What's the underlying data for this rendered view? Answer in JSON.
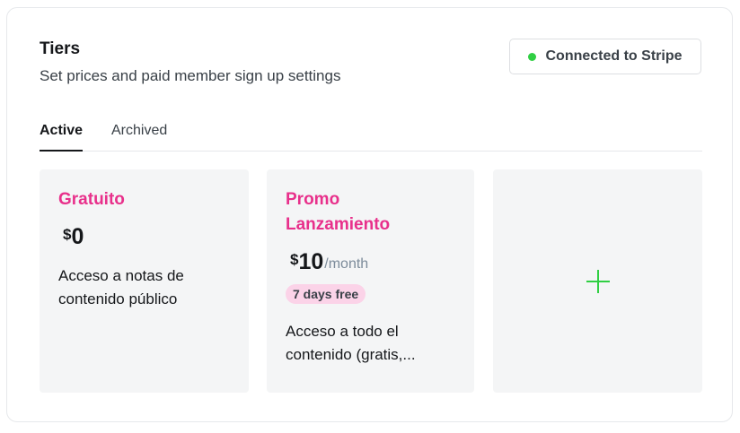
{
  "header": {
    "title": "Tiers",
    "subtitle": "Set prices and paid member sign up settings",
    "stripe_status": "Connected to Stripe"
  },
  "tabs": [
    {
      "label": "Active",
      "selected": true
    },
    {
      "label": "Archived",
      "selected": false
    }
  ],
  "tiers": [
    {
      "name": "Gratuito",
      "currency": "$",
      "amount": "0",
      "period": "",
      "badge": "",
      "description": "Acceso a notas de contenido público"
    },
    {
      "name_line1": "Promo",
      "name_line2": "Lanzamiento",
      "currency": "$",
      "amount": "10",
      "period": "/month",
      "badge": "7 days free",
      "description": "Acceso a todo el contenido (gratis,..."
    }
  ],
  "add_card": {
    "icon": "plus-icon"
  },
  "colors": {
    "accent_pink": "#e8308b",
    "stripe_green": "#30cf43",
    "card_bg": "#f4f5f6",
    "badge_bg": "#fbd3e8"
  }
}
